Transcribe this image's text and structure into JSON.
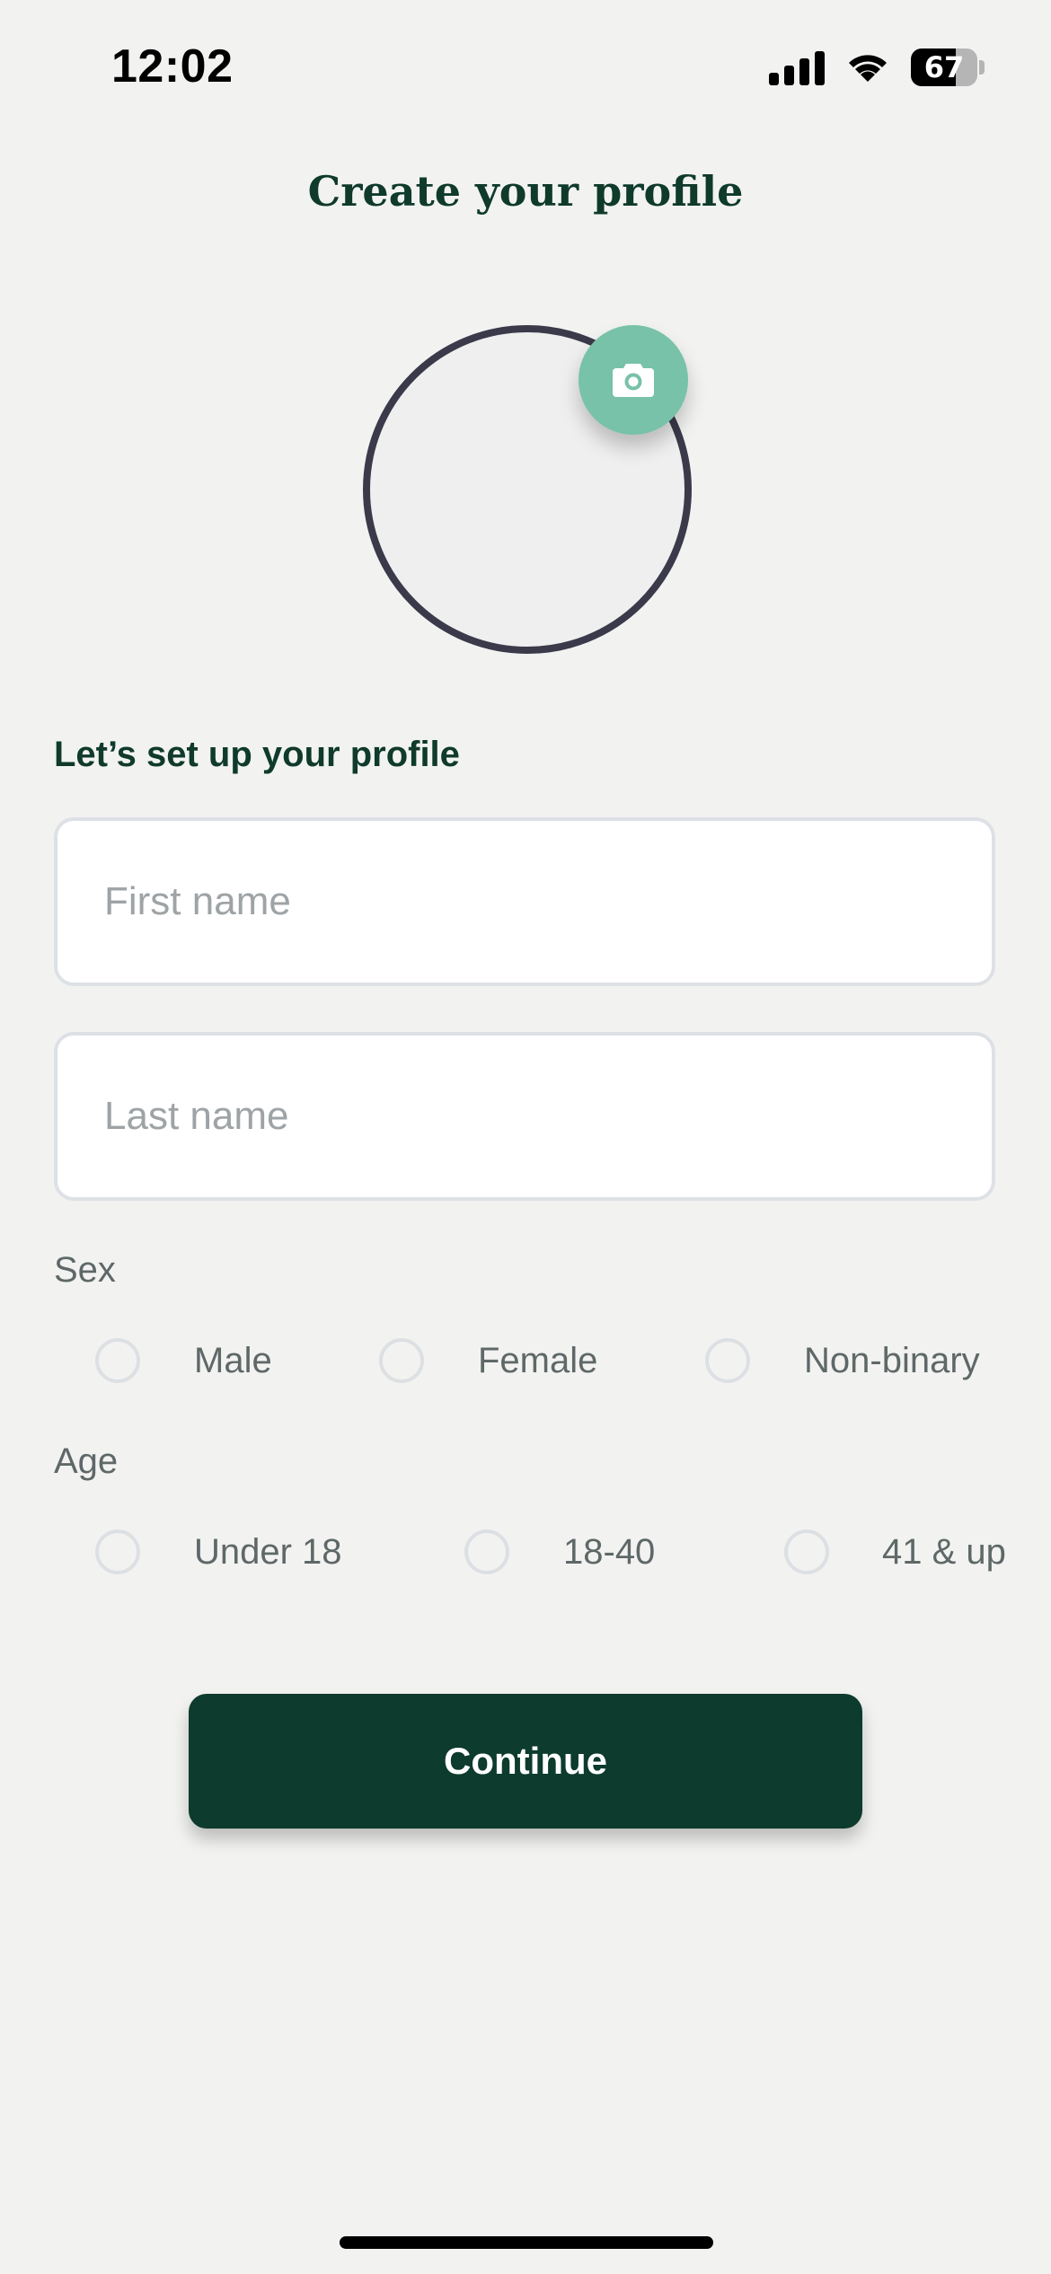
{
  "status_bar": {
    "time": "12:02",
    "battery_level": "67"
  },
  "header": {
    "title": "Create your profile"
  },
  "avatar": {
    "camera_icon": "camera-icon"
  },
  "form": {
    "section_label": "Let’s set up your profile",
    "first_name": {
      "placeholder": "First name",
      "value": ""
    },
    "last_name": {
      "placeholder": "Last name",
      "value": ""
    },
    "sex": {
      "label": "Sex",
      "options": [
        "Male",
        "Female",
        "Non-binary"
      ]
    },
    "age": {
      "label": "Age",
      "options": [
        "Under 18",
        "18-40",
        "41 & up"
      ]
    },
    "continue_label": "Continue"
  },
  "colors": {
    "background": "#f2f3f1",
    "brand_dark_green": "#0d3b2d",
    "accent_mint": "#77c2a8"
  }
}
